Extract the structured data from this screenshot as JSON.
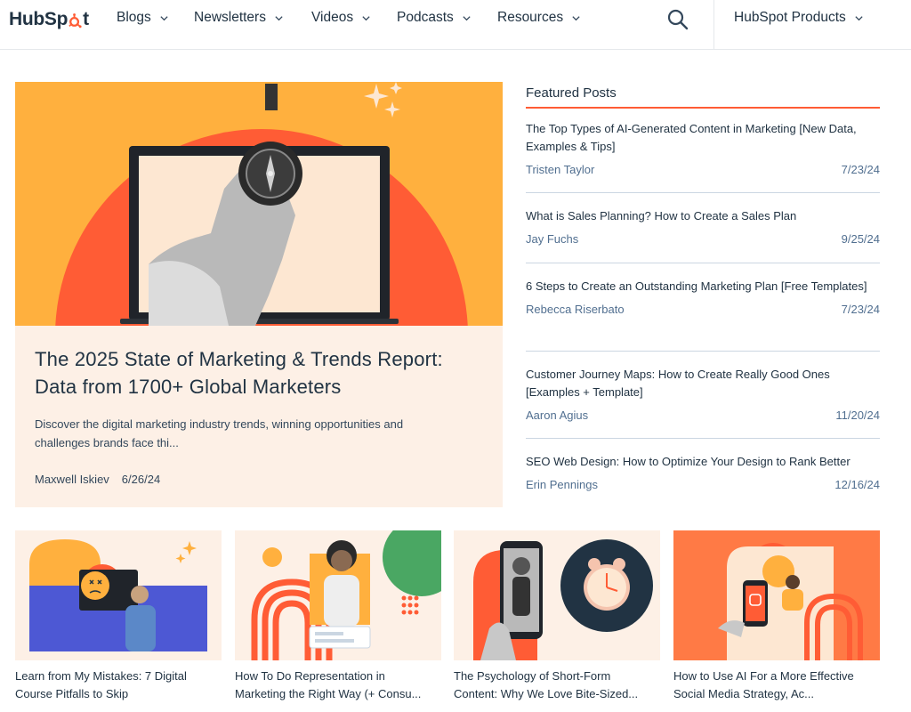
{
  "nav": {
    "logo_left": "HubSp",
    "logo_right": "t",
    "items": [
      {
        "label": "Blogs"
      },
      {
        "label": "Newsletters"
      },
      {
        "label": "Videos"
      },
      {
        "label": "Podcasts"
      },
      {
        "label": "Resources"
      }
    ],
    "products_label": "HubSpot Products",
    "icons": [
      "search-icon",
      "chevron-down-icon",
      "sprocket-logo-icon"
    ]
  },
  "hero": {
    "title": "The 2025 State of Marketing & Trends Report: Data from 1700+ Global Marketers",
    "description": "Discover the digital marketing industry trends, winning opportunities and challenges brands face thi...",
    "author": "Maxwell Iskiev",
    "date": "6/26/24"
  },
  "featured": {
    "heading": "Featured Posts",
    "posts": [
      {
        "title": "The Top Types of AI-Generated Content in Marketing [New Data, Examples & Tips]",
        "author": "Tristen Taylor",
        "date": "7/23/24"
      },
      {
        "title": "What is Sales Planning? How to Create a Sales Plan",
        "author": "Jay Fuchs",
        "date": "9/25/24"
      },
      {
        "title": "6 Steps to Create an Outstanding Marketing Plan [Free Templates]",
        "author": "Rebecca Riserbato",
        "date": "7/23/24"
      },
      {
        "title": "Customer Journey Maps: How to Create Really Good Ones [Examples + Template]",
        "author": "Aaron Agius",
        "date": "11/20/24"
      },
      {
        "title": "SEO Web Design: How to Optimize Your Design to Rank Better",
        "author": "Erin Pennings",
        "date": "12/16/24"
      }
    ]
  },
  "cards": [
    {
      "line1": "Learn from My Mistakes: 7 Digital",
      "line2": "Course Pitfalls to Skip"
    },
    {
      "line1": "How To Do Representation in",
      "line2": "Marketing the Right Way (+ Consu..."
    },
    {
      "line1": "The Psychology of Short-Form",
      "line2": "Content: Why We Love Bite-Sized..."
    },
    {
      "line1": "How to Use AI For a More Effective",
      "line2": "Social Media Strategy, Ac..."
    }
  ],
  "colors": {
    "accent": "#ff5c35",
    "text": "#213343",
    "hero_bg": "#fdf0e6",
    "orange": "#ffb03e"
  }
}
